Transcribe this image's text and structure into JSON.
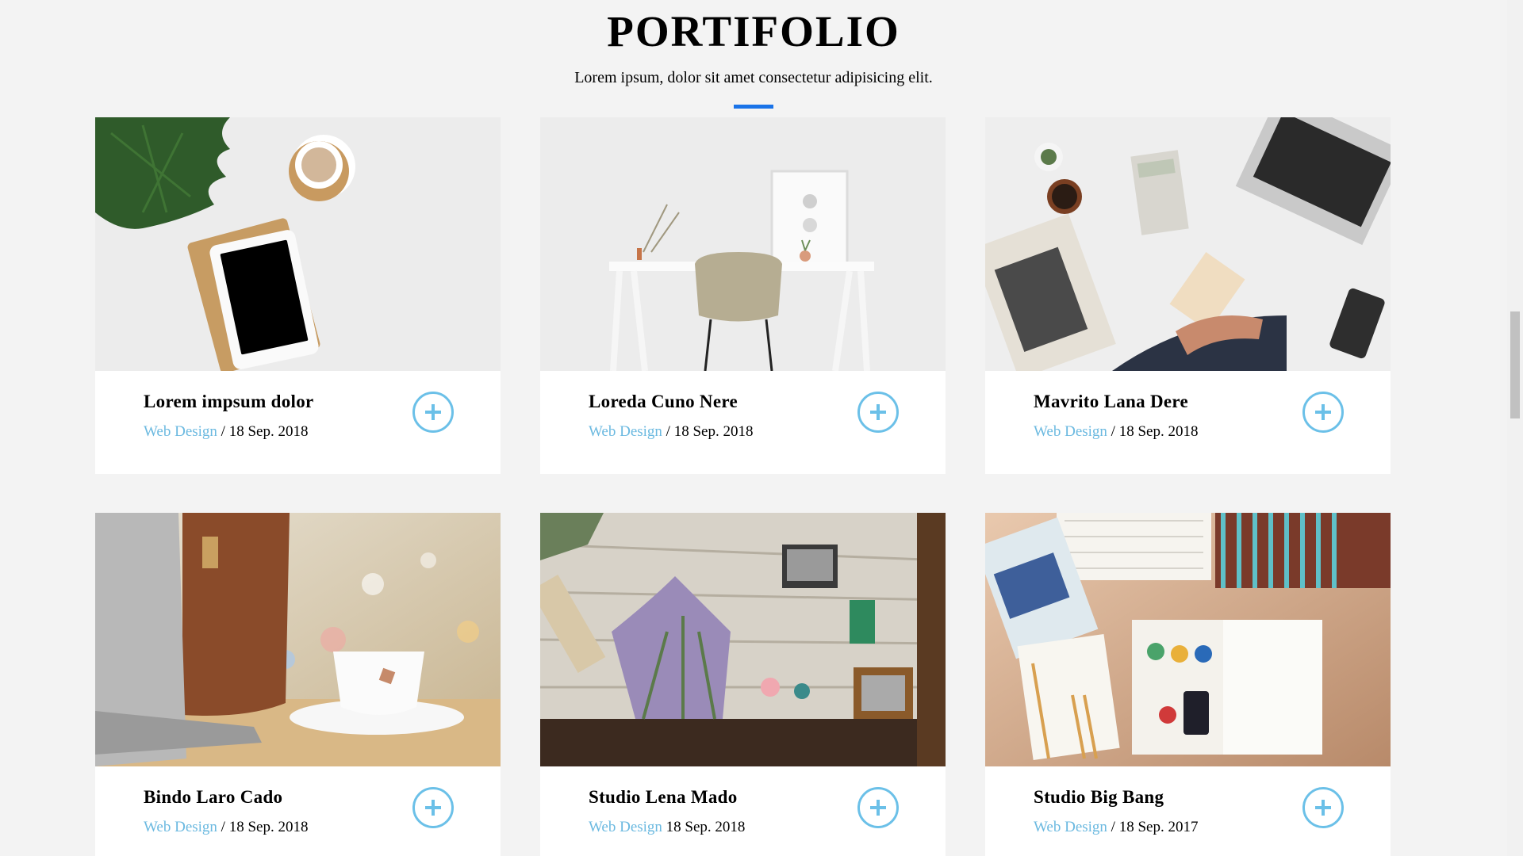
{
  "header": {
    "title": "PORTIFOLIO",
    "subtitle": "Lorem ipsum, dolor sit amet consectetur adipisicing elit.",
    "accent_color": "#1a73e8"
  },
  "cards": [
    {
      "title": "Lorem impsum dolor",
      "category": "Web Design",
      "separator": " / ",
      "date": "18 Sep. 2018",
      "image": "tablet-plant-coffee-photo"
    },
    {
      "title": "Loreda Cuno Nere",
      "category": "Web Design",
      "separator": " / ",
      "date": "18 Sep. 2018",
      "image": "white-desk-chair-photo"
    },
    {
      "title": "Mavrito Lana Dere",
      "category": "Web Design",
      "separator": " / ",
      "date": "18 Sep. 2018",
      "image": "business-desk-laptop-photo"
    },
    {
      "title": "Bindo Laro Cado",
      "category": "Web Design",
      "separator": " / ",
      "date": "18 Sep. 2018",
      "image": "laptop-coffee-cup-photo"
    },
    {
      "title": "Studio Lena Mado",
      "category": "Web Design",
      "separator": " ",
      "date": "18 Sep. 2018",
      "image": "flowers-workbench-photo"
    },
    {
      "title": "Studio Big Bang",
      "category": "Web Design",
      "separator": " / ",
      "date": "18 Sep. 2017",
      "image": "design-books-desk-photo"
    }
  ],
  "colors": {
    "category_link": "#6bb9e0",
    "plus_button": "#6bc0e8",
    "background": "#f3f3f3"
  },
  "icons": {
    "card_button": "plus-circle-icon"
  }
}
